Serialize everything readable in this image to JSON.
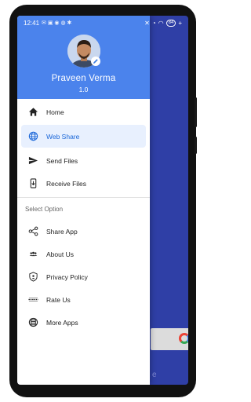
{
  "status_bar": {
    "time": "12:41",
    "battery": "84"
  },
  "drawer": {
    "user_name": "Praveen Verma",
    "version": "1.0",
    "primary_items": [
      {
        "label": "Home",
        "icon": "home-icon"
      },
      {
        "label": "Web Share",
        "icon": "globe-icon",
        "selected": true
      },
      {
        "label": "Send Files",
        "icon": "send-icon"
      },
      {
        "label": "Receive Files",
        "icon": "receive-phone-icon"
      }
    ],
    "section_title": "Select Option",
    "secondary_items": [
      {
        "label": "Share App",
        "icon": "share-icon"
      },
      {
        "label": "About Us",
        "icon": "group-icon"
      },
      {
        "label": "Privacy Policy",
        "icon": "shield-icon"
      },
      {
        "label": "Rate Us",
        "icon": "rating-icon"
      },
      {
        "label": "More Apps",
        "icon": "apps-icon"
      }
    ]
  },
  "background_app": {
    "hint_text": "e"
  },
  "colors": {
    "header": "#4b83ec",
    "app_background": "#2f3fa6",
    "selected_bg": "#e8f0fe",
    "selected_text": "#1a66d8"
  }
}
